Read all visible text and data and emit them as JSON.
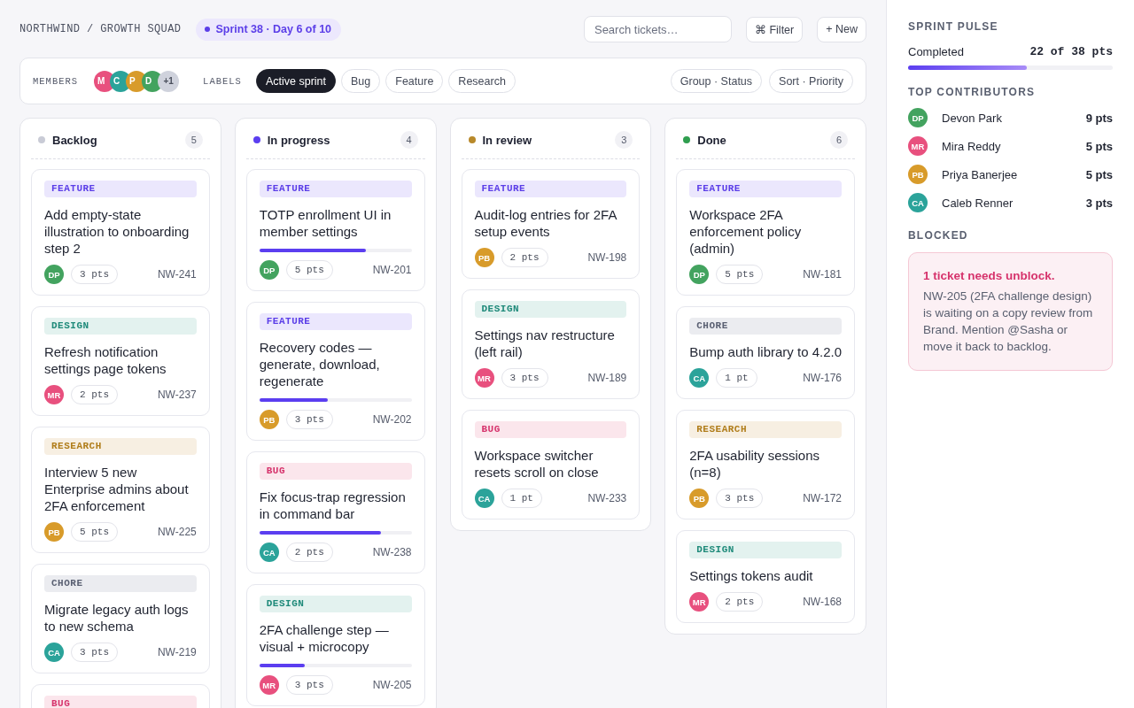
{
  "header": {
    "breadcrumb": "NORTHWIND / GROWTH SQUAD",
    "sprint_badge": "Sprint 38 · Day 6 of 10",
    "search": {
      "placeholder": "Search tickets…"
    },
    "buttons": [
      "⌘ Filter",
      "+ New"
    ]
  },
  "filter_bar": {
    "members_label": "MEMBERS",
    "members": [
      {
        "initials": "M",
        "color": "#e8507e"
      },
      {
        "initials": "C",
        "color": "#2ba39a"
      },
      {
        "initials": "P",
        "color": "#d89b2a"
      },
      {
        "initials": "D",
        "color": "#43a35f"
      }
    ],
    "members_more": "+1",
    "labels_label": "LABELS",
    "labels": [
      {
        "label": "Active sprint",
        "selected": true
      },
      {
        "label": "Bug",
        "selected": false
      },
      {
        "label": "Feature",
        "selected": false
      },
      {
        "label": "Research",
        "selected": false
      }
    ],
    "view_buttons": [
      "Group · Status",
      "Sort · Priority"
    ]
  },
  "columns": [
    {
      "name": "Backlog",
      "color": "#c9cbd6",
      "count": "5",
      "cards": [
        {
          "tag": {
            "kind": "feature",
            "label": "FEATURE"
          },
          "title": "Add empty-state illustration to onboarding step 2",
          "assignee": {
            "initials": "DP",
            "color": "#43a35f"
          },
          "points": "3 pts",
          "id": "NW-241"
        },
        {
          "tag": {
            "kind": "design",
            "label": "DESIGN"
          },
          "title": "Refresh notification settings page tokens",
          "assignee": {
            "initials": "MR",
            "color": "#e8507e"
          },
          "points": "2 pts",
          "id": "NW-237"
        },
        {
          "tag": {
            "kind": "research",
            "label": "RESEARCH"
          },
          "title": "Interview 5 new Enterprise admins about 2FA enforcement",
          "assignee": {
            "initials": "PB",
            "color": "#d89b2a"
          },
          "points": "5 pts",
          "id": "NW-225"
        },
        {
          "tag": {
            "kind": "chore",
            "label": "CHORE"
          },
          "title": "Migrate legacy auth logs to new schema",
          "assignee": {
            "initials": "CA",
            "color": "#2ba39a"
          },
          "points": "3 pts",
          "id": "NW-219"
        },
        {
          "tag": {
            "kind": "bug",
            "label": "BUG"
          }
        }
      ]
    },
    {
      "name": "In progress",
      "color": "#5b3ef0",
      "count": "4",
      "cards": [
        {
          "tag": {
            "kind": "feature",
            "label": "FEATURE"
          },
          "title": "TOTP enrollment UI in member settings",
          "level": 0.7,
          "assignee": {
            "initials": "DP",
            "color": "#43a35f"
          },
          "points": "5 pts",
          "id": "NW-201"
        },
        {
          "tag": {
            "kind": "feature",
            "label": "FEATURE"
          },
          "title": "Recovery codes — generate, download, regenerate",
          "level": 0.45,
          "assignee": {
            "initials": "PB",
            "color": "#d89b2a"
          },
          "points": "3 pts",
          "id": "NW-202"
        },
        {
          "tag": {
            "kind": "bug",
            "label": "BUG"
          },
          "title": "Fix focus-trap regression in command bar",
          "level": 0.8,
          "assignee": {
            "initials": "CA",
            "color": "#2ba39a"
          },
          "points": "2 pts",
          "id": "NW-238"
        },
        {
          "tag": {
            "kind": "design",
            "label": "DESIGN"
          },
          "title": "2FA challenge step — visual + microcopy",
          "level": 0.3,
          "assignee": {
            "initials": "MR",
            "color": "#e8507e"
          },
          "points": "3 pts",
          "id": "NW-205"
        }
      ]
    },
    {
      "name": "In review",
      "color": "#b8892a",
      "count": "3",
      "cards": [
        {
          "tag": {
            "kind": "feature",
            "label": "FEATURE"
          },
          "title": "Audit-log entries for 2FA setup events",
          "assignee": {
            "initials": "PB",
            "color": "#d89b2a"
          },
          "points": "2 pts",
          "id": "NW-198"
        },
        {
          "tag": {
            "kind": "design",
            "label": "DESIGN"
          },
          "title": "Settings nav restructure (left rail)",
          "assignee": {
            "initials": "MR",
            "color": "#e8507e"
          },
          "points": "3 pts",
          "id": "NW-189"
        },
        {
          "tag": {
            "kind": "bug",
            "label": "BUG"
          },
          "title": "Workspace switcher resets scroll on close",
          "assignee": {
            "initials": "CA",
            "color": "#2ba39a"
          },
          "points": "1 pt",
          "id": "NW-233"
        }
      ]
    },
    {
      "name": "Done",
      "color": "#2f9e4f",
      "count": "6",
      "cards": [
        {
          "tag": {
            "kind": "feature",
            "label": "FEATURE"
          },
          "title": "Workspace 2FA enforcement policy (admin)",
          "assignee": {
            "initials": "DP",
            "color": "#43a35f"
          },
          "points": "5 pts",
          "id": "NW-181"
        },
        {
          "tag": {
            "kind": "chore",
            "label": "CHORE"
          },
          "title": "Bump auth library to 4.2.0",
          "assignee": {
            "initials": "CA",
            "color": "#2ba39a"
          },
          "points": "1 pt",
          "id": "NW-176"
        },
        {
          "tag": {
            "kind": "research",
            "label": "RESEARCH"
          },
          "title": "2FA usability sessions (n=8)",
          "assignee": {
            "initials": "PB",
            "color": "#d89b2a"
          },
          "points": "3 pts",
          "id": "NW-172"
        },
        {
          "tag": {
            "kind": "design",
            "label": "DESIGN"
          },
          "title": "Settings tokens audit",
          "assignee": {
            "initials": "MR",
            "color": "#e8507e"
          },
          "points": "2 pts",
          "id": "NW-168"
        }
      ]
    }
  ],
  "sidebar": {
    "sprint_pulse": {
      "title": "SPRINT PULSE",
      "label": "Completed",
      "value": "22 of 38 pts",
      "level": 0.58
    },
    "top_contributors": {
      "title": "TOP CONTRIBUTORS",
      "items": [
        {
          "initials": "DP",
          "color": "#43a35f",
          "name": "Devon Park",
          "points": "9 pts"
        },
        {
          "initials": "MR",
          "color": "#e8507e",
          "name": "Mira Reddy",
          "points": "5 pts"
        },
        {
          "initials": "PB",
          "color": "#d89b2a",
          "name": "Priya Banerjee",
          "points": "5 pts"
        },
        {
          "initials": "CA",
          "color": "#2ba39a",
          "name": "Caleb Renner",
          "points": "3 pts"
        }
      ]
    },
    "blocked": {
      "title": "BLOCKED",
      "alert_title": "1 ticket needs unblock.",
      "message": "NW-205 (2FA challenge design) is waiting on a copy review from Brand. Mention @Sasha or move it back to backlog."
    }
  }
}
